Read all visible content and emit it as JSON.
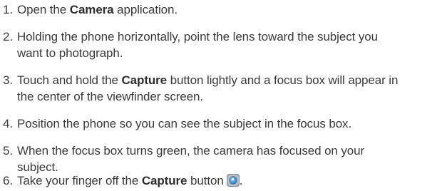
{
  "steps": [
    {
      "number": "1.",
      "before": "Open the ",
      "strong": "Camera",
      "after": " application."
    },
    {
      "number": "2.",
      "line1": "Holding the phone horizontally, point the lens toward the subject you",
      "line2": "want to photograph."
    },
    {
      "number": "3.",
      "before": "Touch and hold the ",
      "strong": "Capture",
      "after": " button lightly and a focus box will appear in",
      "line2": "the center of the viewfinder screen."
    },
    {
      "number": "4.",
      "line1": "Position the phone so you can see the subject in the focus box."
    },
    {
      "number": "5.",
      "line1": "When the focus box turns green, the camera has focused on your",
      "line2": "subject."
    },
    {
      "number": "6.",
      "before": "Take your finger off the ",
      "strong": "Capture",
      "after": " button",
      "icon": "capture-button-icon",
      "end": "."
    }
  ]
}
